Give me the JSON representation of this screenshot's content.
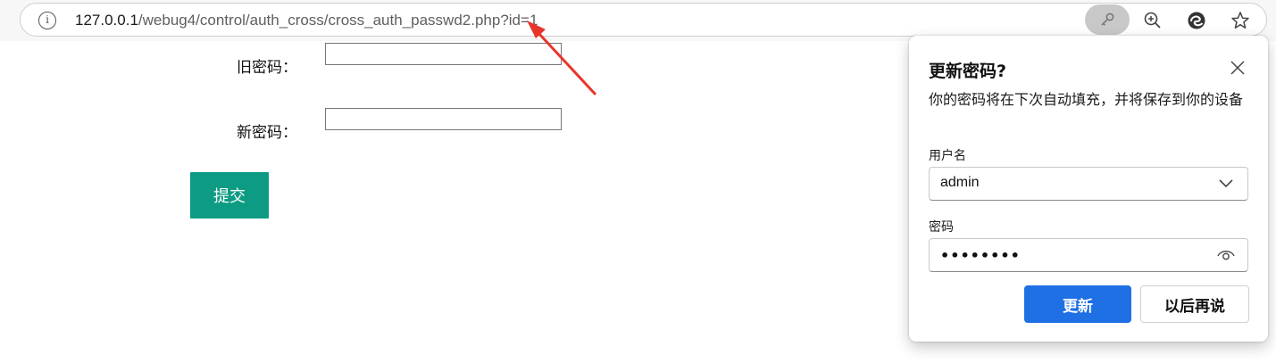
{
  "browser": {
    "url_host": "127.0.0.1",
    "url_path": "/webug4/control/auth_cross/cross_auth_passwd2.php?id=1",
    "info_icon": "info-icon",
    "toolbar_icons": [
      "key-icon",
      "zoom-icon",
      "edge-icon",
      "favorite-star-icon"
    ]
  },
  "form": {
    "old_password_label": "旧密码：",
    "new_password_label": "新密码：",
    "submit_label": "提交",
    "submit_color": "#0d9b83"
  },
  "popup": {
    "title": "更新密码?",
    "description": "你的密码将在下次自动填充，并将保存到你的设备",
    "username_label": "用户名",
    "username_value": "admin",
    "password_label": "密码",
    "password_value": "••••••••",
    "update_button": "更新",
    "later_button": "以后再说",
    "accent_color": "#1f6fe5"
  },
  "annotation": {
    "arrow_color": "#e8352b"
  }
}
